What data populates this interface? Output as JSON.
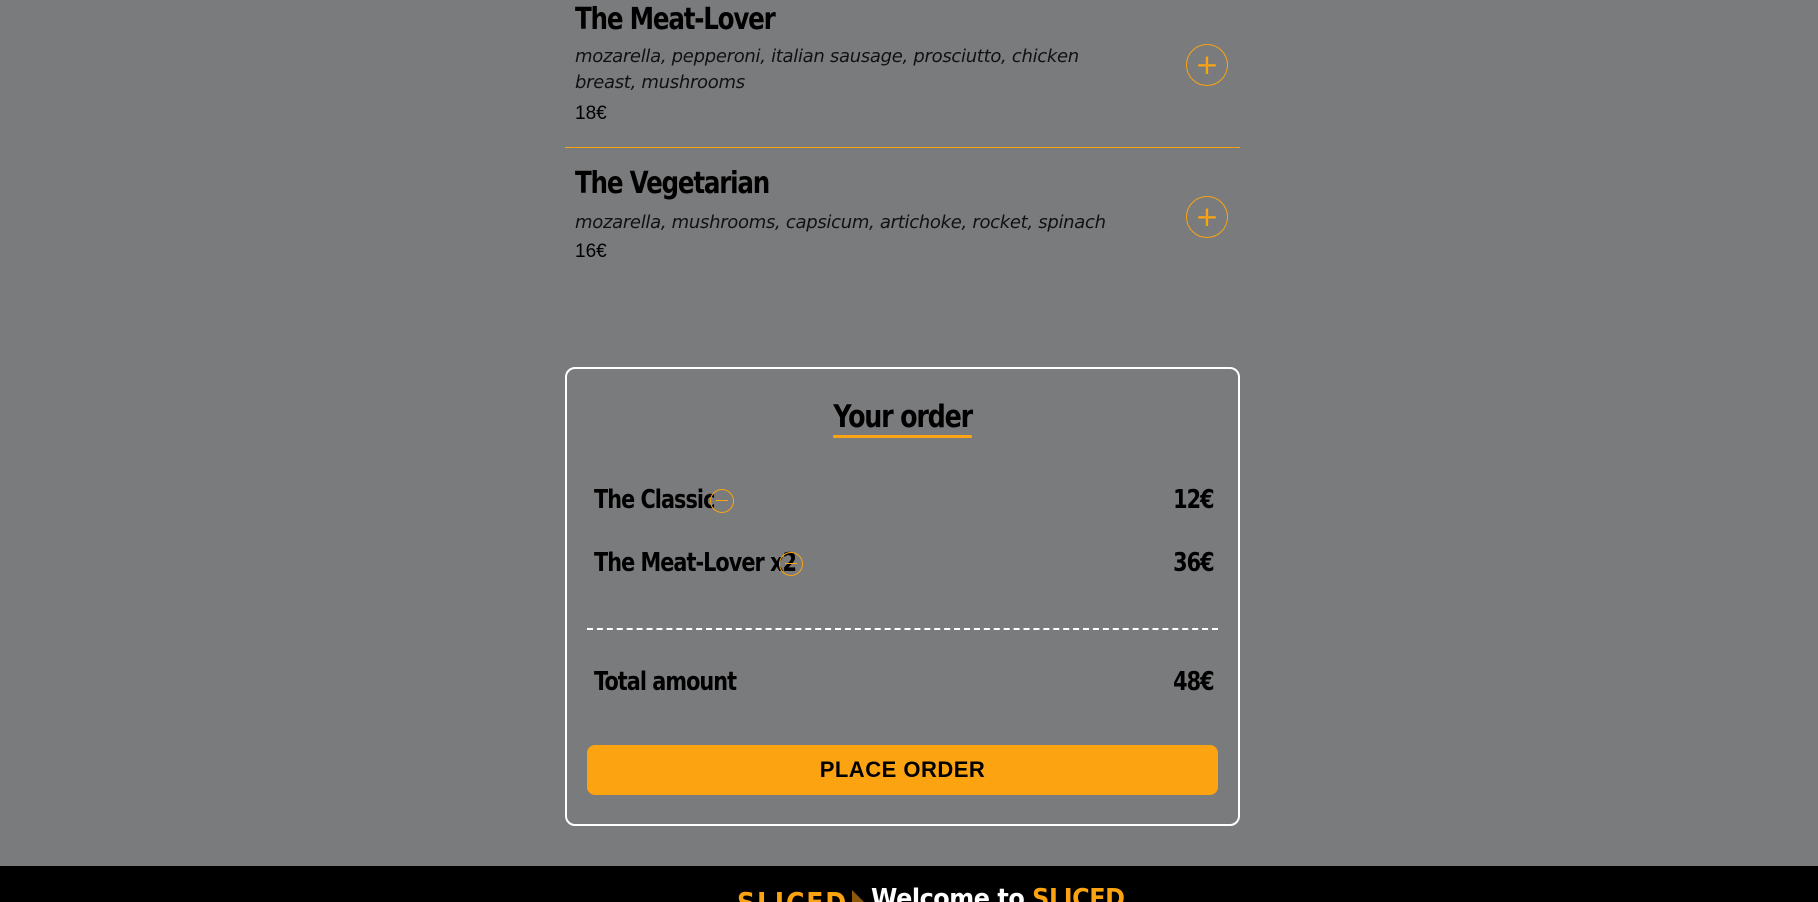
{
  "menu": {
    "pizzas": [
      {
        "name": "The Meat-Lover",
        "ingredients": "mozarella, pepperoni, italian sausage, prosciutto, chicken breast, mushrooms",
        "price": "18€",
        "add_symbol": "+"
      },
      {
        "name": "The Vegetarian",
        "ingredients": "mozarella, mushrooms, capsicum, artichoke, rocket, spinach",
        "price": "16€",
        "add_symbol": "+"
      }
    ]
  },
  "order": {
    "title": "Your order",
    "items": [
      {
        "name": "The Classic",
        "price": "12€"
      },
      {
        "name": "The Meat-Lover x2",
        "price": "36€"
      }
    ],
    "total_label": "Total amount",
    "total_value": "48€",
    "place_order_label": "PLACE ORDER"
  },
  "footer": {
    "logo": "SLICED",
    "welcome_prefix": "Welcome to ",
    "welcome_brand": "SLICED"
  },
  "colors": {
    "background": "#7a7b7d",
    "accent": "#fca311",
    "footer": "#000000",
    "border": "#ffffff"
  },
  "icons": {
    "add": "plus-circle-icon",
    "remove": "minus-circle-icon",
    "logo_slice": "pizza-slice-icon"
  }
}
